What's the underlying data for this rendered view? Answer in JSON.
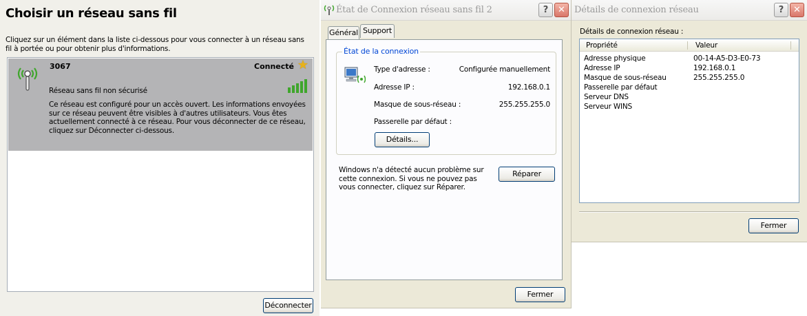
{
  "wireless_list": {
    "title": "Choisir un réseau sans fil",
    "description": "Cliquez sur un élément dans la liste ci-dessous pour vous connecter à un réseau sans fil à portée ou pour obtenir plus d'informations.",
    "network": {
      "ssid": "3067",
      "status": "Connecté",
      "security": "Réseau sans fil non sécurisé",
      "details": "Ce réseau est configuré pour un accès ouvert. Les informations envoyées sur ce réseau peuvent être visibles à d'autres utilisateurs. Vous êtes actuellement connecté à ce réseau. Pour vous déconnecter de ce réseau, cliquez sur Déconnecter ci-dessous.",
      "signal_icon": "signal-bars-icon",
      "status_icon": "star-icon",
      "network_icon": "wireless-antenna-icon",
      "colors": {
        "selected_background": "#b4b4b6",
        "signal": "#3fa62c"
      }
    },
    "disconnect_label": "Déconnecter"
  },
  "status_dialog": {
    "title": "État de Connexion réseau sans fil 2",
    "help_button": "?",
    "close_button": "✕",
    "tabs": [
      {
        "label": "Général"
      },
      {
        "label": "Support"
      }
    ],
    "active_tab": "Support",
    "group_label": "État de la connexion",
    "rows": [
      {
        "label": "Type d'adresse :",
        "value": "Configurée manuellement"
      },
      {
        "label": "Adresse IP :",
        "value": "192.168.0.1"
      },
      {
        "label": "Masque de sous-réseau :",
        "value": "255.255.255.0"
      },
      {
        "label": "Passerelle par défaut :",
        "value": ""
      }
    ],
    "details_button": "Détails...",
    "help_text": "Windows n'a détecté aucun problème sur cette connexion. Si vous ne pouvez pas vous connecter, cliquez sur Réparer.",
    "repair_button": "Réparer",
    "close_label": "Fermer",
    "colors": {
      "group_label": "#0046d5",
      "active_tab_accent": "#e69a1e"
    }
  },
  "details_dialog": {
    "title": "Détails de connexion réseau",
    "help_button": "?",
    "close_button": "✕",
    "section_label": "Détails de connexion réseau :",
    "columns": [
      "Propriété",
      "Valeur"
    ],
    "rows": [
      {
        "property": "Adresse physique",
        "value": "00-14-A5-D3-E0-73"
      },
      {
        "property": "Adresse IP",
        "value": "192.168.0.1"
      },
      {
        "property": "Masque de sous-réseau",
        "value": "255.255.255.0"
      },
      {
        "property": "Passerelle par défaut",
        "value": ""
      },
      {
        "property": "Serveur DNS",
        "value": ""
      },
      {
        "property": "Serveur WINS",
        "value": ""
      }
    ],
    "close_label": "Fermer"
  }
}
